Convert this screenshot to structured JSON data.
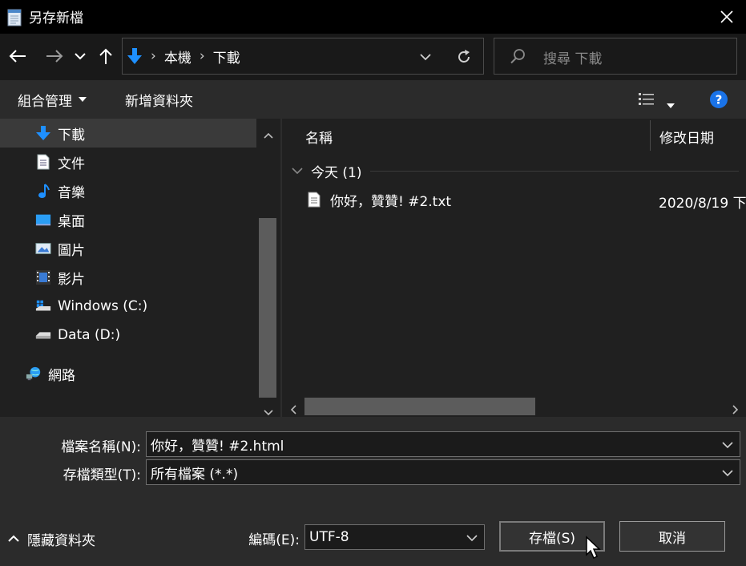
{
  "window": {
    "title": "另存新檔"
  },
  "address": {
    "crumbs": [
      "本機",
      "下載"
    ]
  },
  "search": {
    "placeholder": "搜尋 下載"
  },
  "toolbar": {
    "organize": "組合管理",
    "new_folder": "新增資料夾"
  },
  "sidebar": {
    "items": [
      {
        "label": "下載",
        "icon": "download-arrow-icon",
        "selected": true
      },
      {
        "label": "文件",
        "icon": "document-icon"
      },
      {
        "label": "音樂",
        "icon": "music-note-icon"
      },
      {
        "label": "桌面",
        "icon": "desktop-icon"
      },
      {
        "label": "圖片",
        "icon": "picture-icon"
      },
      {
        "label": "影片",
        "icon": "video-icon"
      },
      {
        "label": "Windows (C:)",
        "icon": "windows-drive-icon"
      },
      {
        "label": "Data (D:)",
        "icon": "drive-icon"
      },
      {
        "label": "網路",
        "icon": "network-icon"
      }
    ]
  },
  "files": {
    "columns": {
      "name": "名稱",
      "modified": "修改日期"
    },
    "group": "今天 (1)",
    "rows": [
      {
        "name": "你好，贊贊! #2.txt",
        "modified": "2020/8/19 下"
      }
    ]
  },
  "form": {
    "filename_label": "檔案名稱(N):",
    "filename_value": "你好，贊贊! #2.html",
    "filetype_label": "存檔類型(T):",
    "filetype_value": "所有檔案  (*.*)",
    "encoding_label": "編碼(E):",
    "encoding_value": "UTF-8"
  },
  "footer": {
    "hide_folders": "隱藏資料夾",
    "save": "存檔(S)",
    "cancel": "取消"
  },
  "colors": {
    "accent_blue": "#1e90ff",
    "help_blue": "#1a73e8",
    "background": "#202020"
  }
}
